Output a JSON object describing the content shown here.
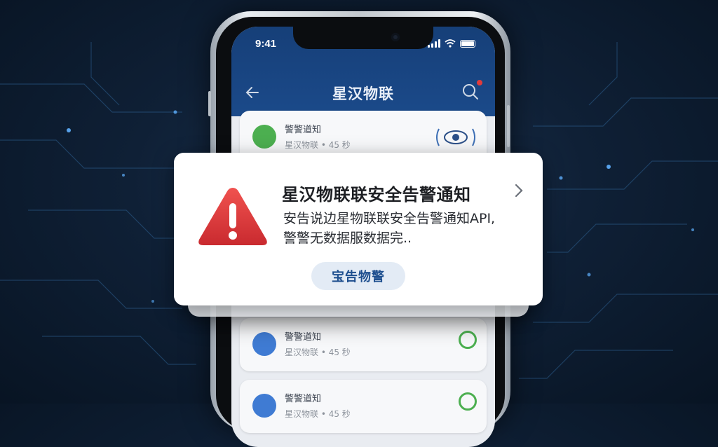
{
  "status_bar": {
    "time": "9:41"
  },
  "app_bar": {
    "title": "星汉物联"
  },
  "list_items": [
    {
      "title": "警警道知",
      "subtitle": "星汉物联 • 45 秒",
      "icon": "router-icon",
      "right_icon": "eye-scan-icon"
    },
    {
      "title": "警警道知",
      "subtitle": "星汉物联 • 45 秒",
      "icon": "pin-icon",
      "right_icon": "status-icon"
    },
    {
      "title": "警警道知",
      "subtitle": "星汉物联 • 45 秒",
      "icon": "app-store-icon",
      "right_icon": "user-icon"
    }
  ],
  "alert": {
    "title": "星汉物联联安全告警通知",
    "body_line1": "安告说边星物联联安全告警通知API,",
    "body_line2": "警警无数据服数据完..",
    "action_label": "宝告物警",
    "icon": "warning-triangle-icon"
  },
  "colors": {
    "appbar": "#1b4a8a",
    "alert_red": "#e0373c",
    "action_bg": "#e3ebf5",
    "action_text": "#1e4f8f"
  }
}
